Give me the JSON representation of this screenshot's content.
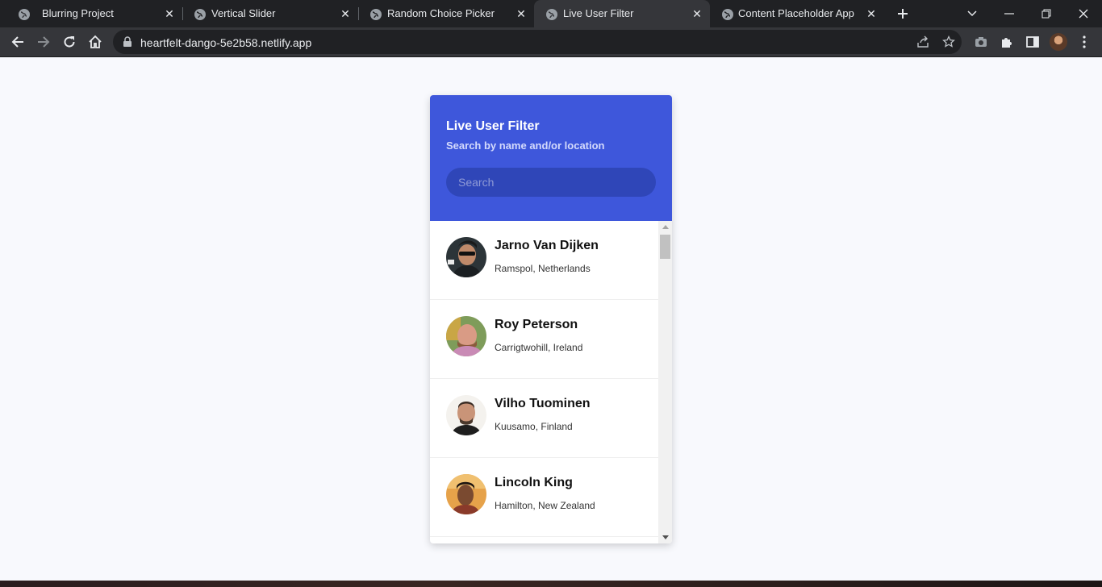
{
  "browser": {
    "tabs": [
      {
        "title": "Blurring Project",
        "active": false
      },
      {
        "title": "Vertical Slider",
        "active": false
      },
      {
        "title": "Random Choice Picker",
        "active": false
      },
      {
        "title": "Live User Filter",
        "active": true
      },
      {
        "title": "Content Placeholder App",
        "active": false
      }
    ],
    "url": "heartfelt-dango-5e2b58.netlify.app"
  },
  "page": {
    "title": "Live User Filter",
    "subtitle": "Search by name and/or location",
    "search_placeholder": "Search",
    "users": [
      {
        "name": "Jarno Van Dijken",
        "location": "Ramspol, Netherlands"
      },
      {
        "name": "Roy Peterson",
        "location": "Carrigtwohill, Ireland"
      },
      {
        "name": "Vilho Tuominen",
        "location": "Kuusamo, Finland"
      },
      {
        "name": "Lincoln King",
        "location": "Hamilton, New Zealand"
      }
    ]
  },
  "colors": {
    "header_bg": "#3e57db",
    "search_bg": "#2f46b8",
    "page_bg": "#f8f9fd"
  }
}
